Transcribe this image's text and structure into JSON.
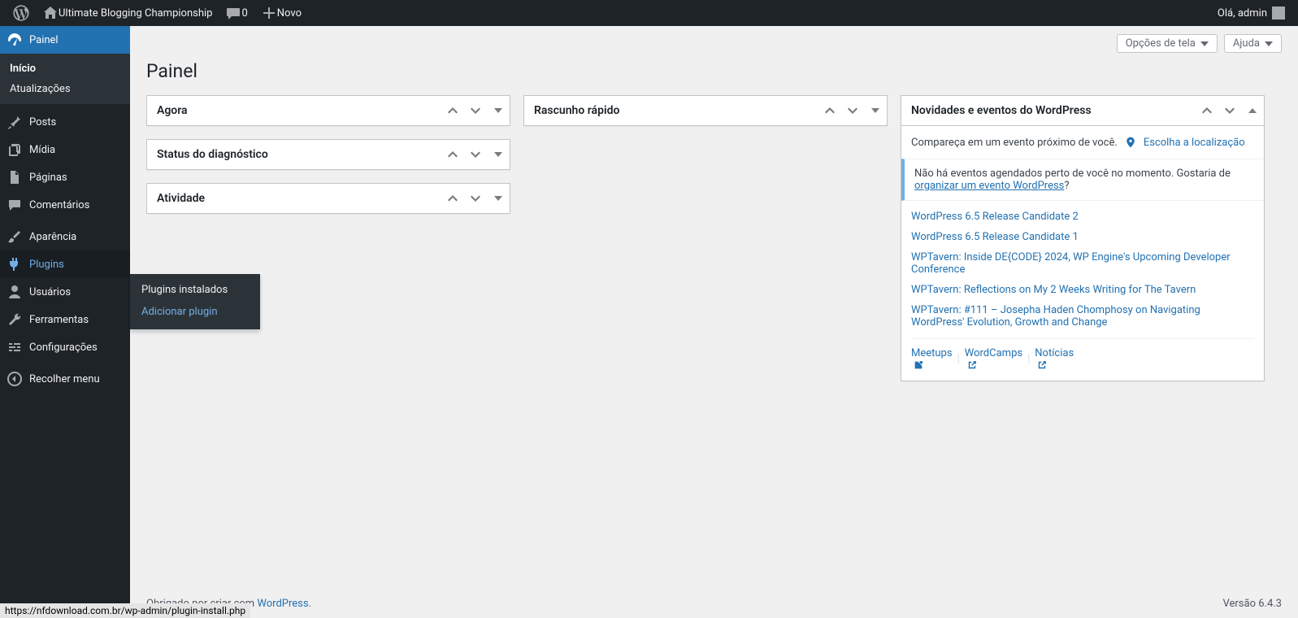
{
  "adminbar": {
    "site_name": "Ultimate Blogging Championship",
    "comments_count": "0",
    "new_label": "Novo",
    "howdy": "Olá, admin"
  },
  "sidebar": {
    "dashboard": "Painel",
    "dashboard_sub": {
      "home": "Início",
      "updates": "Atualizações"
    },
    "posts": "Posts",
    "media": "Mídia",
    "pages": "Páginas",
    "comments": "Comentários",
    "appearance": "Aparência",
    "plugins": "Plugins",
    "plugins_sub": {
      "installed": "Plugins instalados",
      "add": "Adicionar plugin"
    },
    "users": "Usuários",
    "tools": "Ferramentas",
    "settings": "Configurações",
    "collapse": "Recolher menu"
  },
  "header": {
    "screen_options": "Opções de tela",
    "help": "Ajuda",
    "page_title": "Painel"
  },
  "widgets": {
    "now": "Agora",
    "health": "Status do diagnóstico",
    "activity": "Atividade",
    "quick_draft": "Rascunho rápido",
    "news_title": "Novidades e eventos do WordPress"
  },
  "news": {
    "attend": "Compareça em um evento próximo de você.",
    "choose_location": "Escolha a localização",
    "no_events_pre": "Não há eventos agendados perto de você no momento. Gostaria de ",
    "no_events_link": "organizar um evento WordPress",
    "no_events_post": "?",
    "items": [
      "WordPress 6.5 Release Candidate 2",
      "WordPress 6.5 Release Candidate 1",
      "WPTavern: Inside DE{CODE} 2024, WP Engine's Upcoming Developer Conference",
      "WPTavern: Reflections on My 2 Weeks Writing for The Tavern",
      "WPTavern: #111 – Josepha Haden Chomphosy on Navigating WordPress' Evolution, Growth and Change"
    ],
    "footer": {
      "meetups": "Meetups",
      "wordcamps": "WordCamps",
      "news": "Notícias"
    }
  },
  "footer": {
    "thanks_pre": "Obrigado por criar com ",
    "wp_link": "WordPress",
    "thanks_post": ".",
    "version": "Versão 6.4.3"
  },
  "statusbar": "https://nfdownload.com.br/wp-admin/plugin-install.php"
}
